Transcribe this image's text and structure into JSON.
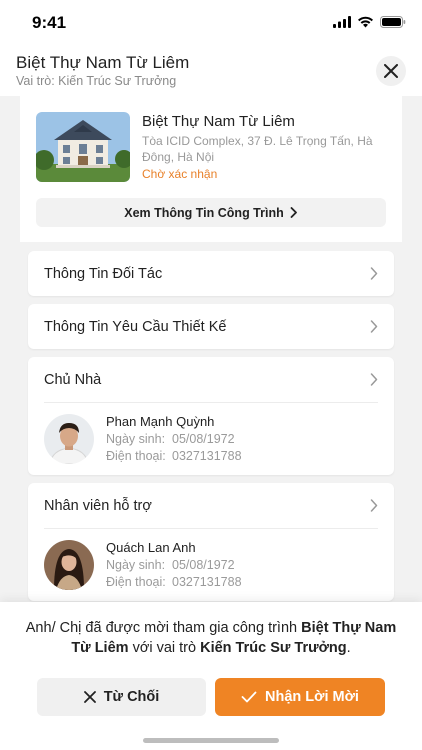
{
  "status_bar": {
    "time": "9:41"
  },
  "header": {
    "title": "Biệt Thự Nam Từ Liêm",
    "subtitle": "Vai trò: Kiến Trúc Sư Trưởng"
  },
  "project": {
    "name": "Biệt Thự Nam Từ Liêm",
    "address": "Tòa ICID Complex, 37 Đ. Lê Trọng Tấn, Hà Đông, Hà Nội",
    "status": "Chờ xác nhận",
    "status_color": "#e8812a",
    "view_button": "Xem Thông Tin Công Trình"
  },
  "sections": {
    "partner": "Thông Tin Đối Tác",
    "design_request": "Thông Tin Yêu Cầu Thiết Kế",
    "owner": {
      "label": "Chủ Nhà",
      "name": "Phan Mạnh Quỳnh",
      "dob_label": "Ngày sinh:",
      "dob": "05/08/1972",
      "phone_label": "Điện thoại:",
      "phone": "0327131788"
    },
    "support": {
      "label": "Nhân viên hỗ trợ",
      "name": "Quách Lan Anh",
      "dob_label": "Ngày sinh:",
      "dob": "05/08/1972",
      "phone_label": "Điện thoại:",
      "phone": "0327131788"
    }
  },
  "invite": {
    "prefix": "Anh/ Chị đã được mời tham gia công trình ",
    "project": "Biệt Thự Nam Từ Liêm",
    "middle": " với vai trò ",
    "role": "Kiến Trúc Sư Trưởng",
    "suffix": "."
  },
  "actions": {
    "decline": "Từ Chối",
    "accept": "Nhận Lời Mời",
    "accent_color": "#ef8424"
  }
}
